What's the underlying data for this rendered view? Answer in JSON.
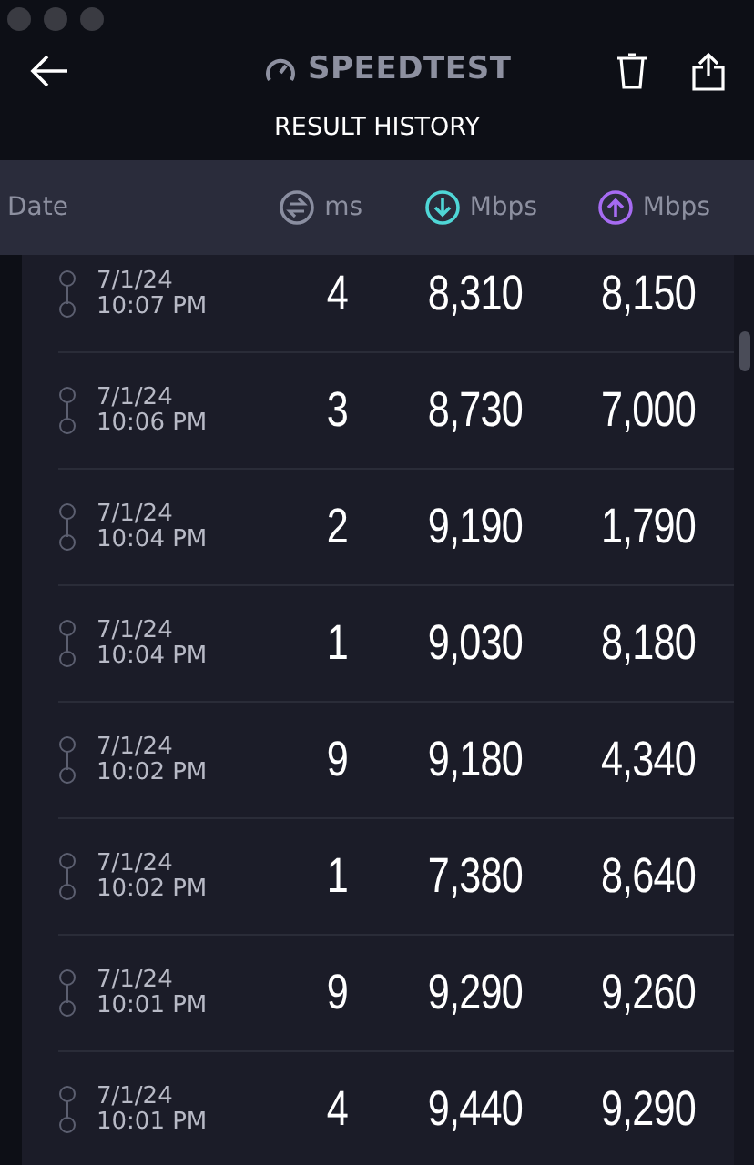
{
  "header": {
    "logo": "SPEEDTEST",
    "title": "RESULT HISTORY"
  },
  "columns": [
    {
      "label": "Date",
      "kind": "date"
    },
    {
      "label": "ms",
      "kind": "ping"
    },
    {
      "label": "Mbps",
      "kind": "download"
    },
    {
      "label": "Mbps",
      "kind": "upload"
    }
  ],
  "rows": [
    {
      "date": "7/1/24",
      "time": "10:07 PM",
      "ping": "4",
      "download": "8,310",
      "upload": "8,150"
    },
    {
      "date": "7/1/24",
      "time": "10:06 PM",
      "ping": "3",
      "download": "8,730",
      "upload": "7,000"
    },
    {
      "date": "7/1/24",
      "time": "10:04 PM",
      "ping": "2",
      "download": "9,190",
      "upload": "1,790"
    },
    {
      "date": "7/1/24",
      "time": "10:04 PM",
      "ping": "1",
      "download": "9,030",
      "upload": "8,180"
    },
    {
      "date": "7/1/24",
      "time": "10:02 PM",
      "ping": "9",
      "download": "9,180",
      "upload": "4,340"
    },
    {
      "date": "7/1/24",
      "time": "10:02 PM",
      "ping": "1",
      "download": "7,380",
      "upload": "8,640"
    },
    {
      "date": "7/1/24",
      "time": "10:01 PM",
      "ping": "9",
      "download": "9,290",
      "upload": "9,260"
    },
    {
      "date": "7/1/24",
      "time": "10:01 PM",
      "ping": "4",
      "download": "9,440",
      "upload": "9,290"
    }
  ]
}
